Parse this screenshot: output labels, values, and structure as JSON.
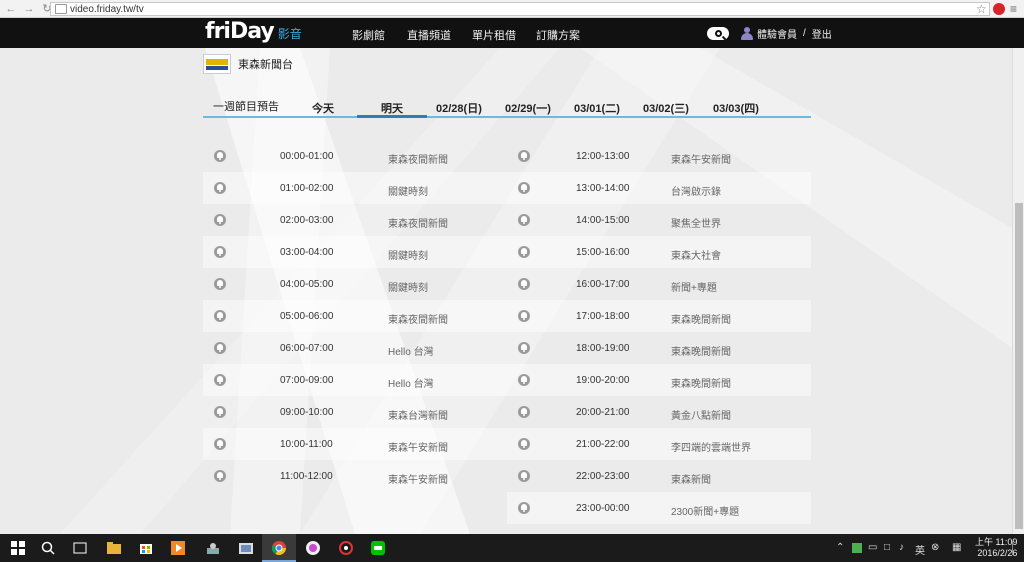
{
  "browser": {
    "url": "video.friday.tw/tv"
  },
  "header": {
    "logo_main": "friDay",
    "logo_sub": "影音",
    "nav": [
      "影劇館",
      "直播頻道",
      "單片租借",
      "訂購方案"
    ],
    "user_label": "體驗會員",
    "separator": "/",
    "logout": "登出"
  },
  "channel": {
    "name": "東森新聞台"
  },
  "tabs": {
    "section_label": "一週節目預告",
    "items": [
      "今天",
      "明天",
      "02/28(日)",
      "02/29(一)",
      "03/01(二)",
      "03/02(三)",
      "03/03(四)"
    ],
    "selected": "明天"
  },
  "schedule": {
    "left": [
      {
        "time": "00:00-01:00",
        "title": "東森夜間新聞"
      },
      {
        "time": "01:00-02:00",
        "title": "關鍵時刻"
      },
      {
        "time": "02:00-03:00",
        "title": "東森夜間新聞"
      },
      {
        "time": "03:00-04:00",
        "title": "關鍵時刻"
      },
      {
        "time": "04:00-05:00",
        "title": "關鍵時刻"
      },
      {
        "time": "05:00-06:00",
        "title": "東森夜間新聞"
      },
      {
        "time": "06:00-07:00",
        "title": "Hello 台灣"
      },
      {
        "time": "07:00-09:00",
        "title": "Hello 台灣"
      },
      {
        "time": "09:00-10:00",
        "title": "東森台灣新聞"
      },
      {
        "time": "10:00-11:00",
        "title": "東森午安新聞"
      },
      {
        "time": "11:00-12:00",
        "title": "東森午安新聞"
      }
    ],
    "right": [
      {
        "time": "12:00-13:00",
        "title": "東森午安新聞"
      },
      {
        "time": "13:00-14:00",
        "title": "台灣啟示錄"
      },
      {
        "time": "14:00-15:00",
        "title": "聚焦全世界"
      },
      {
        "time": "15:00-16:00",
        "title": "東森大社會"
      },
      {
        "time": "16:00-17:00",
        "title": "新聞+專題"
      },
      {
        "time": "17:00-18:00",
        "title": "東森晚間新聞"
      },
      {
        "time": "18:00-19:00",
        "title": "東森晚間新聞"
      },
      {
        "time": "19:00-20:00",
        "title": "東森晚間新聞"
      },
      {
        "time": "20:00-21:00",
        "title": "黃金八點新聞"
      },
      {
        "time": "21:00-22:00",
        "title": "李四端的雲端世界"
      },
      {
        "time": "22:00-23:00",
        "title": "東森新聞"
      },
      {
        "time": "23:00-00:00",
        "title": "2300新聞+專題"
      }
    ]
  },
  "taskbar": {
    "ime": "英",
    "time": "上午 11:09",
    "date": "2016/2/26"
  },
  "colors": {
    "topbar": "#111111",
    "accent_blue": "#2b7fb6",
    "tab_line": "#6bbbe0",
    "logo_sub": "#3aa7e0"
  },
  "icons": [
    "back-icon",
    "forward-icon",
    "reload-icon",
    "star-icon",
    "search-icon",
    "user-icon",
    "bell-icon",
    "windows-icon",
    "chrome-icon"
  ]
}
